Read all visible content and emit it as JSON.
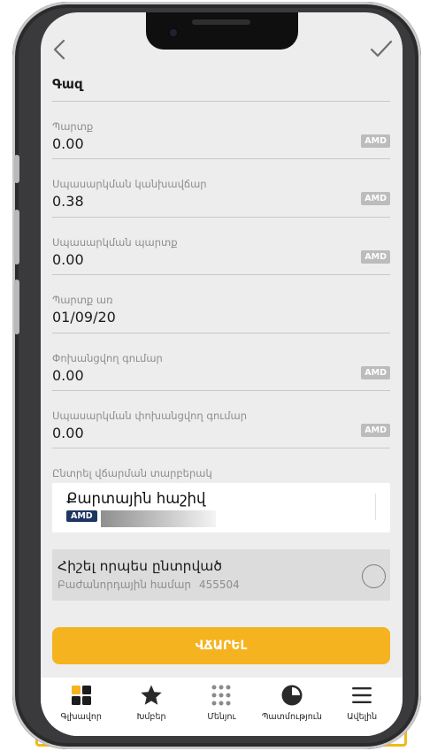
{
  "colors": {
    "accent": "#f5b320",
    "badge": "#1f3663",
    "background": "#ededed"
  },
  "header": {
    "title": "Գազ"
  },
  "fields": [
    {
      "label": "Պարտք",
      "value": "0.00",
      "currency": "AMD"
    },
    {
      "label": "Սպասարկման կանխավճար",
      "value": "0.38",
      "currency": "AMD"
    },
    {
      "label": "Սպասարկման պարտք",
      "value": "0.00",
      "currency": "AMD"
    },
    {
      "label": "Պարտք առ",
      "value": "01/09/20"
    },
    {
      "label": "Փոխանցվող գումար",
      "value": "0.00",
      "currency": "AMD"
    },
    {
      "label": "Սպասարկման փոխանցվող գումար",
      "value": "0.00",
      "currency": "AMD"
    }
  ],
  "payment_method": {
    "label": "Ընտրել վճարման տարբերակ",
    "card_title": "Քարտային հաշիվ",
    "card_currency": "AMD"
  },
  "remember": {
    "title": "Հիշել որպես ընտրված",
    "subscriber_label": "Բաժանորդային համար",
    "subscriber_number": "455504"
  },
  "pay_button": "ՎՃԱՐԵԼ",
  "tabbar": [
    {
      "label": "Գլխավոր",
      "icon": "home-grid-icon"
    },
    {
      "label": "Խմբեր",
      "icon": "star-icon"
    },
    {
      "label": "Մենյու",
      "icon": "menu-dots-icon"
    },
    {
      "label": "Պատմություն",
      "icon": "history-pie-icon"
    },
    {
      "label": "Ավելին",
      "icon": "hamburger-icon"
    }
  ]
}
